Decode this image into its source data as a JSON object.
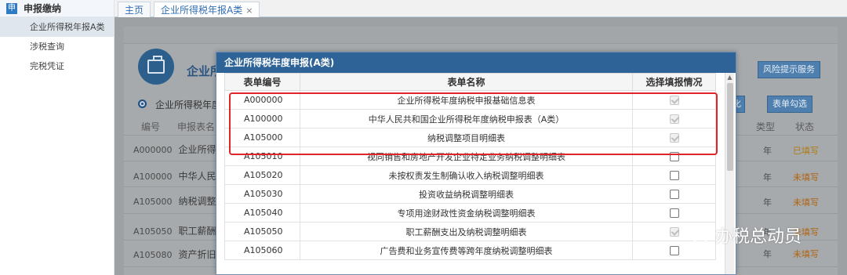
{
  "sidebar": {
    "badge": "申",
    "title": "申报缴纳",
    "items": [
      {
        "label": "企业所得税年报A类",
        "active": true
      },
      {
        "label": "涉税查询"
      },
      {
        "label": "完税凭证"
      }
    ]
  },
  "tabs": {
    "home": "主页",
    "active": "企业所得税年报A类",
    "close": "×"
  },
  "background": {
    "title": "企业所",
    "risk_button": "风险提示服务",
    "hua_button": "化",
    "select_button": "表单勾选",
    "radio_label": "企业所得税年度",
    "headers": {
      "code": "编号",
      "name": "申报表名",
      "type": "类型",
      "status": "状态"
    },
    "rows": [
      {
        "code": "A000000",
        "name": "企业所得",
        "type": "年",
        "status": "已填写"
      },
      {
        "code": "A100000",
        "name": "中华人民",
        "type": "年",
        "status": "未填写"
      },
      {
        "code": "A105000",
        "name": "纳税调整",
        "type": "年",
        "status": "未填写"
      },
      {
        "code": "A105050",
        "name": "职工薪酬",
        "type": "年",
        "status": "未填写"
      },
      {
        "code": "A105080",
        "name": "资产折旧",
        "type": "年",
        "status": "未填写"
      }
    ]
  },
  "modal": {
    "title": "企业所得税年度申报(A类)",
    "columns": {
      "code": "表单编号",
      "name": "表单名称",
      "status": "选择填报情况"
    },
    "rows": [
      {
        "code": "A000000",
        "name": "企业所得税年度纳税申报基础信息表",
        "checked": true,
        "disabled": true
      },
      {
        "code": "A100000",
        "name": "中华人民共和国企业所得税年度纳税申报表（A类）",
        "checked": true,
        "disabled": true
      },
      {
        "code": "A105000",
        "name": "纳税调整项目明细表",
        "checked": true,
        "disabled": true
      },
      {
        "code": "A105010",
        "name": "视同销售和房地产开发企业特定业务纳税调整明细表",
        "checked": false
      },
      {
        "code": "A105020",
        "name": "未按权责发生制确认收入纳税调整明细表",
        "checked": false
      },
      {
        "code": "A105030",
        "name": "投资收益纳税调整明细表",
        "checked": false
      },
      {
        "code": "A105040",
        "name": "专项用途财政性资金纳税调整明细表",
        "checked": false
      },
      {
        "code": "A105050",
        "name": "职工薪酬支出及纳税调整明细表",
        "checked": true,
        "disabled": true
      },
      {
        "code": "A105060",
        "name": "广告费和业务宣传费等跨年度纳税调整明细表",
        "checked": false
      }
    ]
  },
  "watermark": "办税总动员",
  "colors": {
    "highlight": "#e0242b",
    "modal_header": "#2d6396",
    "accent": "#2f6db5"
  }
}
